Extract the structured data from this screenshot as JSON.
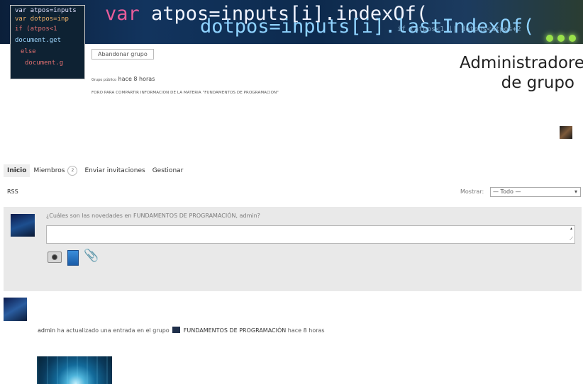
{
  "cover": {
    "code_line1_keyword": "var",
    "code_line1_rest": " atpos=inputs[i].indexOf(",
    "code_line2": "dotpos=inputs[i].lastIndexOf(",
    "code_line3": "if (atpos<1 || dotpos<atpos+2"
  },
  "group_avatar": {
    "code_lines": [
      "var atpos=inputs",
      "var dotpos=inp",
      "if (atpos<1",
      "document.get",
      "else",
      "document.g"
    ]
  },
  "header": {
    "leave_button": "Abandonar grupo",
    "group_type": "Grupo público",
    "last_active": "hace 8 horas",
    "description": "FORO PARA COMPARTIR INFORMACION DE LA MATERIA \"FUNDAMENTOS DE PROGRAMACION\""
  },
  "admins": {
    "title": "Administradores de grupo"
  },
  "tabs": [
    {
      "label": "Inicio",
      "active": true
    },
    {
      "label": "Miembros",
      "count": "2"
    },
    {
      "label": "Enviar invitaciones"
    },
    {
      "label": "Gestionar"
    }
  ],
  "feed_controls": {
    "rss": "RSS",
    "show_label": "Mostrar:",
    "show_selected": "— Todo —"
  },
  "status": {
    "prompt": "¿Cuáles son las novedades en FUNDAMENTOS DE PROGRAMACIÓN, admin?",
    "input_value": ""
  },
  "activity": {
    "user": "admin",
    "action": " ha actualizado una entrada en el grupo ",
    "group": "FUNDAMENTOS DE PROGRAMACIÓN",
    "time": " hace 8 horas"
  },
  "colors": {
    "accent_panel": "#e9e9e9",
    "cover_keyword": "#e95d9a"
  }
}
